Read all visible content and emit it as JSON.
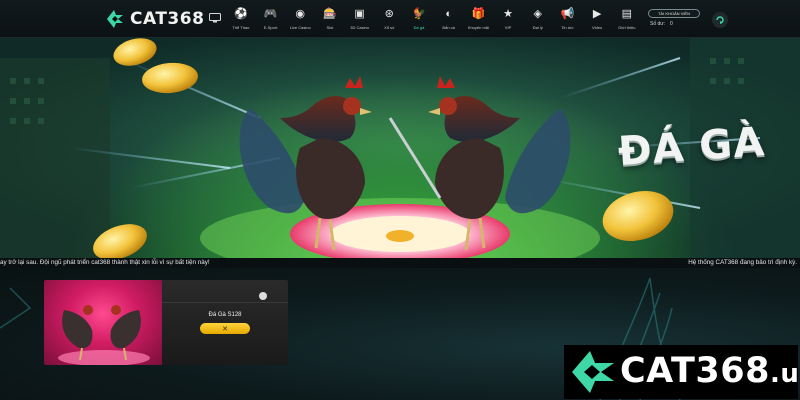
{
  "header": {
    "logo_text": "CAT368",
    "nav": [
      {
        "label": "Thể Thao",
        "icon": "soccer-ball-icon",
        "glyph": "⚽"
      },
      {
        "label": "E-Sport",
        "icon": "gamepad-icon",
        "glyph": "🎮"
      },
      {
        "label": "Live Casino",
        "icon": "poker-chip-icon",
        "glyph": "◉"
      },
      {
        "label": "Slot",
        "icon": "slot-machine-icon",
        "glyph": "🎰"
      },
      {
        "label": "3D Casino",
        "icon": "3d-casino-icon",
        "glyph": "▣"
      },
      {
        "label": "Xổ số",
        "icon": "lottery-ball-icon",
        "glyph": "⊛"
      },
      {
        "label": "Đá gà",
        "icon": "rooster-icon",
        "glyph": "🐓"
      },
      {
        "label": "Bắn cá",
        "icon": "fish-icon",
        "glyph": "◐"
      },
      {
        "label": "Khuyến mãi",
        "icon": "gift-icon",
        "glyph": "🎁"
      },
      {
        "label": "VIP",
        "icon": "star-icon",
        "glyph": "★"
      },
      {
        "label": "Đại lý",
        "icon": "agent-icon",
        "glyph": "◈"
      },
      {
        "label": "Tin tức",
        "icon": "megaphone-icon",
        "glyph": "📢"
      },
      {
        "label": "Video",
        "icon": "play-icon",
        "glyph": "▶"
      },
      {
        "label": "Giới thiệu",
        "icon": "info-icon",
        "glyph": "▤"
      }
    ],
    "active_index": 6,
    "account": {
      "button_label": "TÀI KHOẢN VIÊN",
      "balance_label": "Số dư:",
      "balance_value": "0"
    }
  },
  "banner": {
    "title": "ĐÁ GÀ"
  },
  "marquee": {
    "left_text": "ay trở lại sau. Đội ngũ phát triển cat368 thành thật xin lỗi vì sự bất tiện này!",
    "right_text": "Hệ thống CAT368 đang bảo trì định kỳ."
  },
  "game_card": {
    "title": "Đá Gà S128",
    "play_icon": "close-x-icon",
    "play_glyph": "✕"
  },
  "brand": {
    "name": "CAT368",
    "tld": ".us"
  },
  "colors": {
    "accent": "#3ed8a7",
    "play_button": "#f5be14",
    "banner_green": "#2e8f3a"
  }
}
